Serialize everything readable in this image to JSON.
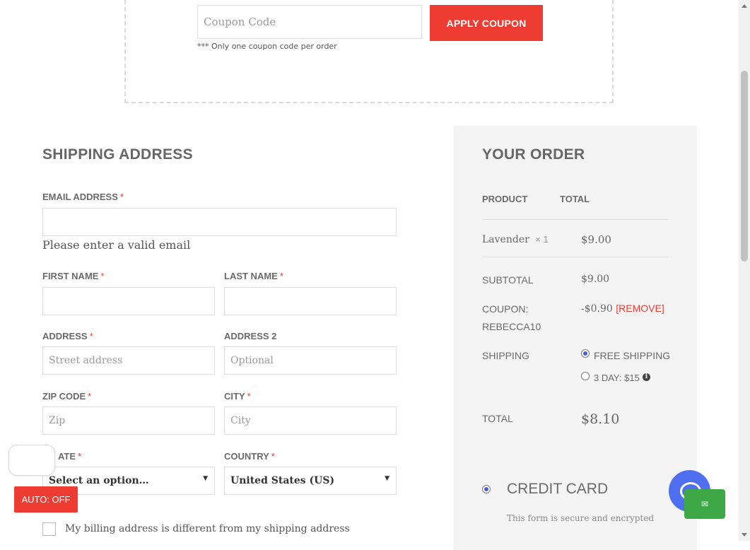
{
  "coupon": {
    "placeholder": "Coupon Code",
    "apply_label": "APPLY COUPON",
    "note": "*** Only one coupon code per order"
  },
  "shipping": {
    "title": "SHIPPING ADDRESS",
    "email_label": "EMAIL ADDRESS",
    "email_error": "Please enter a valid email",
    "first_name_label": "FIRST NAME",
    "last_name_label": "LAST NAME",
    "address_label": "ADDRESS",
    "address_placeholder": "Street address",
    "address2_label": "ADDRESS 2",
    "address2_placeholder": "Optional",
    "zip_label": "ZIP CODE",
    "zip_placeholder": "Zip",
    "city_label": "CITY",
    "city_placeholder": "City",
    "state_label": "ATE",
    "state_value": "Select an option…",
    "country_label": "COUNTRY",
    "country_value": "United States (US)",
    "required_mark": "*",
    "billing_checkbox_label": "My billing address is different from my shipping address"
  },
  "auto_button": "AUTO: OFF",
  "order": {
    "title": "YOUR ORDER",
    "col_product": "PRODUCT",
    "col_total": "TOTAL",
    "item_name": "Lavender",
    "item_qty": "× 1",
    "item_price": "$9.00",
    "subtotal_label": "SUBTOTAL",
    "subtotal_value": "$9.00",
    "coupon_label": "COUPON:",
    "coupon_code": "REBECCA10",
    "coupon_value": "-$0.90",
    "coupon_remove": "[REMOVE]",
    "shipping_label": "SHIPPING",
    "shipping_option_1": "FREE SHIPPING",
    "shipping_option_2": "3 DAY: $15",
    "total_label": "TOTAL",
    "total_value": "$8.10",
    "payment_method": "CREDIT CARD",
    "payment_note": "This form is secure and encrypted"
  },
  "colors": {
    "accent_red": "#ee3c32",
    "radio_blue": "#4a5bd6",
    "chat_blue": "#4f6ff0",
    "chat_green": "#3ea847",
    "panel_bg": "#f4f4f4"
  }
}
